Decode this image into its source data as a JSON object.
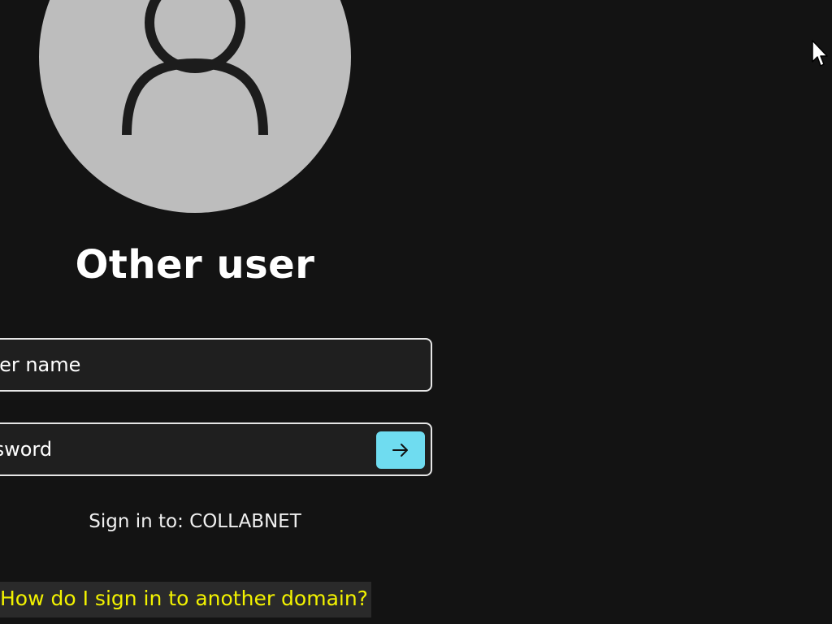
{
  "user": {
    "display_name": "Other user"
  },
  "fields": {
    "username_placeholder": "User name",
    "password_placeholder": "Password"
  },
  "submit": {
    "icon": "arrow-right-icon",
    "color": "#6fdcf0"
  },
  "domain": {
    "sign_in_to": "Sign in to: COLLABNET"
  },
  "help": {
    "link_text": "How do I sign in to another domain?",
    "link_color": "#f2f200"
  },
  "avatar": {
    "icon": "user-silhouette-icon",
    "color": "#bdbdbd"
  }
}
